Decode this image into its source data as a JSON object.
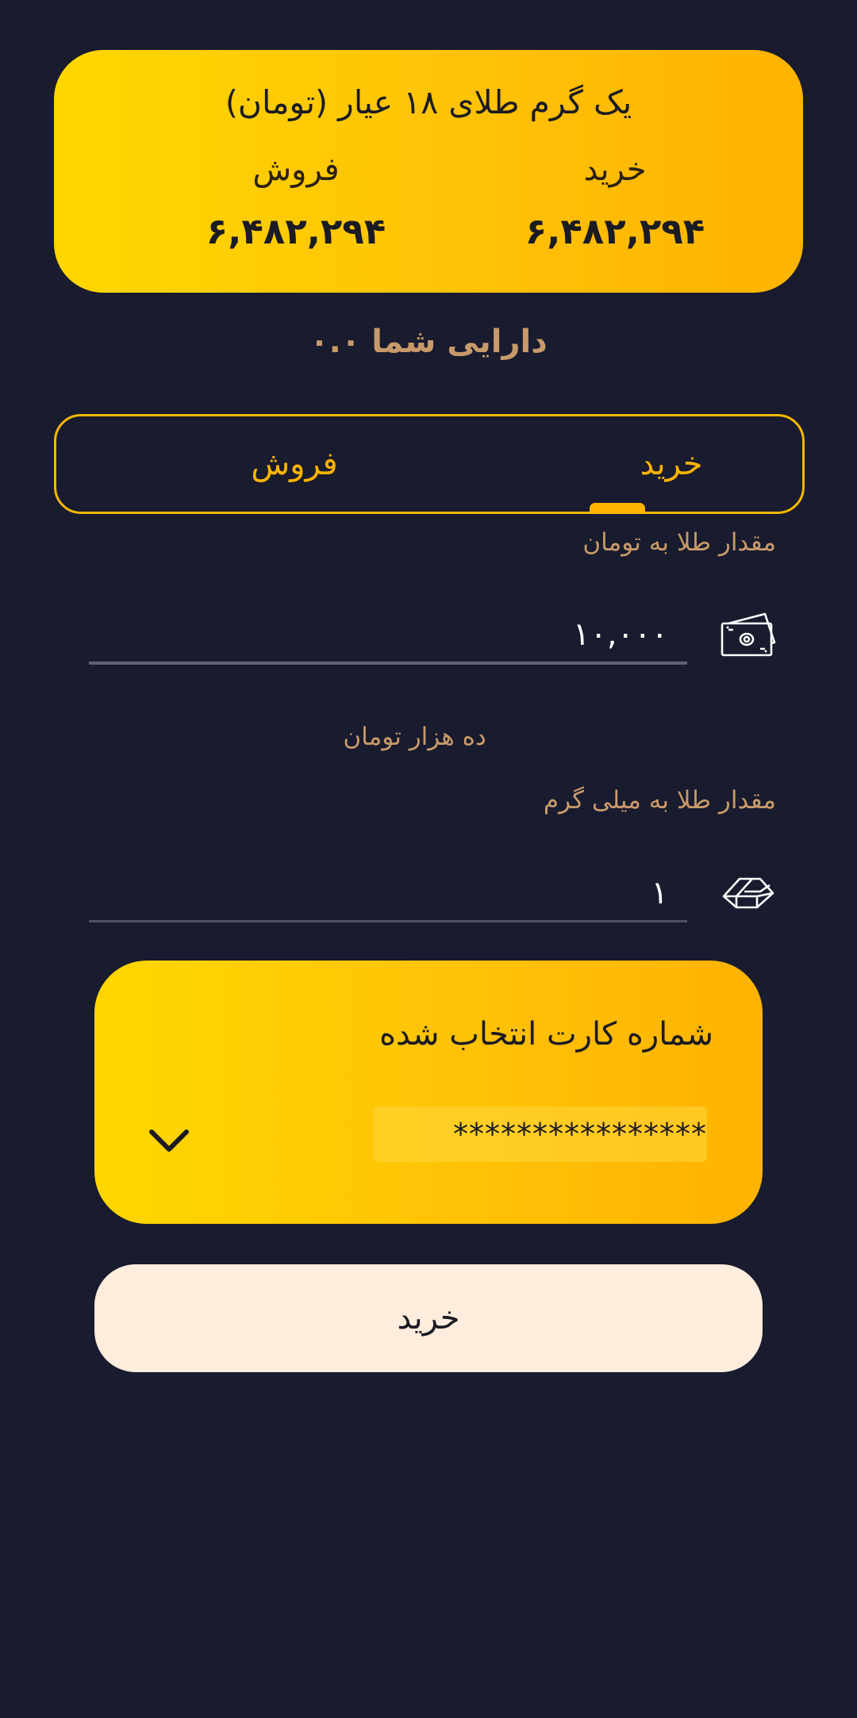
{
  "price_card": {
    "title": "یک گرم طلای ۱۸ عیار (تومان)",
    "buy_label": "خرید",
    "buy_value": "۶,۴۸۲,۲۹۴",
    "sell_label": "فروش",
    "sell_value": "۶,۴۸۲,۲۹۴"
  },
  "assets": {
    "label": "دارایی شما ۰.۰"
  },
  "tabs": {
    "buy": "خرید",
    "sell": "فروش",
    "active": "buy"
  },
  "toman_field": {
    "label": "مقدار طلا به تومان",
    "value": "۱۰,۰۰۰",
    "words": "ده هزار تومان",
    "icon": "money-icon"
  },
  "gram_field": {
    "label": "مقدار طلا به میلی گرم",
    "value": "۱",
    "icon": "gold-bar-icon"
  },
  "card_select": {
    "title": "شماره کارت انتخاب شده",
    "number": "****************",
    "icon": "chevron-down-icon"
  },
  "submit": {
    "label": "خرید"
  },
  "colors": {
    "background": "#191b2e",
    "accent": "#ffb400",
    "gold_start": "#ffd700",
    "gold_end": "#ffb300",
    "muted_label": "#c89a6a",
    "button_bg": "#feecdc"
  }
}
